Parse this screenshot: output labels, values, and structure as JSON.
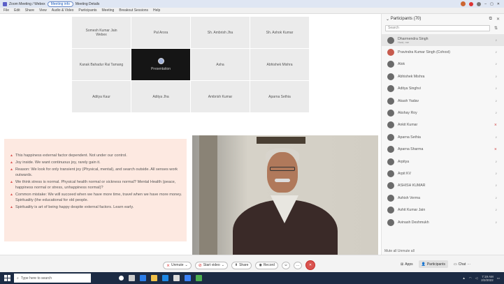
{
  "window": {
    "app_name": "Zoom Meeting / Webex",
    "tab_active": "Meeting info",
    "tab_other": "Meeting Details",
    "menu_items": [
      "File",
      "Edit",
      "Share",
      "View",
      "Audio & Video",
      "Participants",
      "Meeting",
      "Breakout Sessions",
      "Help"
    ]
  },
  "gallery": {
    "tiles": [
      {
        "name": "Somesh Kumar Jain",
        "sub": "Webex",
        "dark": false
      },
      {
        "name": "Pal Arora",
        "dark": false
      },
      {
        "name": "Sh. Ambrish Jha",
        "dark": false
      },
      {
        "name": "Sh. Ashok Kumar",
        "dark": false
      },
      {
        "name": "Kanak Bahadur Rai Tamang",
        "dark": false
      },
      {
        "name": "Presentation",
        "dark": true
      },
      {
        "name": "Asha",
        "dark": false
      },
      {
        "name": "Abhishek Mishra",
        "dark": false
      },
      {
        "name": "Aditya Kaur",
        "dark": false
      },
      {
        "name": "Aditya Jha",
        "dark": false
      },
      {
        "name": "Ambrish Kumar",
        "dark": false
      },
      {
        "name": "Aparna Sethia",
        "dark": false
      }
    ]
  },
  "shared_text": [
    "This happiness external factor dependent. Not under our control.",
    "Joy inside. We want continuous joy, rarely gain it.",
    "Reason: We look for only transient joy (Physical, mental), and search outside. All senses work outwards.",
    "We think stress is normal. Physical health normal or sickness normal? Mental Health (peace, happiness normal or stress, unhappiness normal)?",
    "Common mistake: We will succeed when we have more time, travel when we have more money. Spirituality (the educational for old people.",
    "Spirituality is art of being happy despite external factors. Learn early."
  ],
  "participants": {
    "title": "Participants (70)",
    "search_placeholder": "Search",
    "list": [
      {
        "name": "Dharmendra Singh",
        "sub": "Host, me",
        "avatar": "gray",
        "selected": true,
        "mic": "on"
      },
      {
        "name": "Pravindra Kumar Singh (Cohost)",
        "avatar": "red",
        "selected": false,
        "mic": "on"
      },
      {
        "name": "Alok",
        "avatar": "gray",
        "selected": false,
        "mic": "on"
      },
      {
        "name": "Abhishek Mishra",
        "avatar": "gray",
        "selected": false,
        "mic": "on"
      },
      {
        "name": "Aditya Singhvi",
        "avatar": "gray",
        "selected": false,
        "mic": "on"
      },
      {
        "name": "Akash Yadav",
        "avatar": "gray",
        "selected": false,
        "mic": "on"
      },
      {
        "name": "Akshay Roy",
        "avatar": "gray",
        "selected": false,
        "mic": "on"
      },
      {
        "name": "Ankit Kumar",
        "avatar": "gray",
        "selected": false,
        "mic": "off"
      },
      {
        "name": "Aparna Sethia",
        "avatar": "gray",
        "selected": false,
        "mic": "on"
      },
      {
        "name": "Aparna Sharma",
        "avatar": "gray",
        "selected": false,
        "mic": "off"
      },
      {
        "name": "Arpitya",
        "avatar": "gray",
        "selected": false,
        "mic": "on"
      },
      {
        "name": "Arpit KV",
        "avatar": "gray",
        "selected": false,
        "mic": "on"
      },
      {
        "name": "ASHISH KUMAR",
        "avatar": "gray",
        "selected": false,
        "mic": "on"
      },
      {
        "name": "Ashish Verma",
        "avatar": "gray",
        "selected": false,
        "mic": "on"
      },
      {
        "name": "Ashit Kumar Jain",
        "avatar": "gray",
        "selected": false,
        "mic": "on"
      },
      {
        "name": "Avinash Deshmukh",
        "avatar": "gray",
        "selected": false,
        "mic": "on"
      }
    ],
    "footer": "Mute all  Unmute all"
  },
  "controls": {
    "unmute": "Unmute",
    "start_video": "Start video",
    "share": "Share",
    "record": "Record",
    "apps": "Apps",
    "participants": "Participants",
    "chat": "Chat"
  },
  "taskbar": {
    "search": "Type here to search",
    "time": "7:19 AM",
    "date": "2/2/2022"
  }
}
